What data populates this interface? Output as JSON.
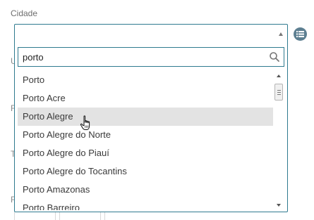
{
  "field": {
    "label": "Cidade",
    "selected_value": ""
  },
  "search": {
    "value": "porto",
    "placeholder": ""
  },
  "options": [
    "Porto",
    "Porto Acre",
    "Porto Alegre",
    "Porto Alegre do Norte",
    "Porto Alegre do Piauí",
    "Porto Alegre do Tocantins",
    "Porto Amazonas",
    "Porto Barreiro"
  ],
  "hovered_option": "Porto Alegre",
  "background_letters": [
    "U",
    "F",
    "T",
    "F"
  ],
  "icons": {
    "list_button": "list-icon",
    "search": "search-icon",
    "cursor": "hand-pointer-icon"
  },
  "colors": {
    "accent_border": "#2f7a8f",
    "list_button": "#5d7f91",
    "hover_bg": "#e3e3e3"
  }
}
